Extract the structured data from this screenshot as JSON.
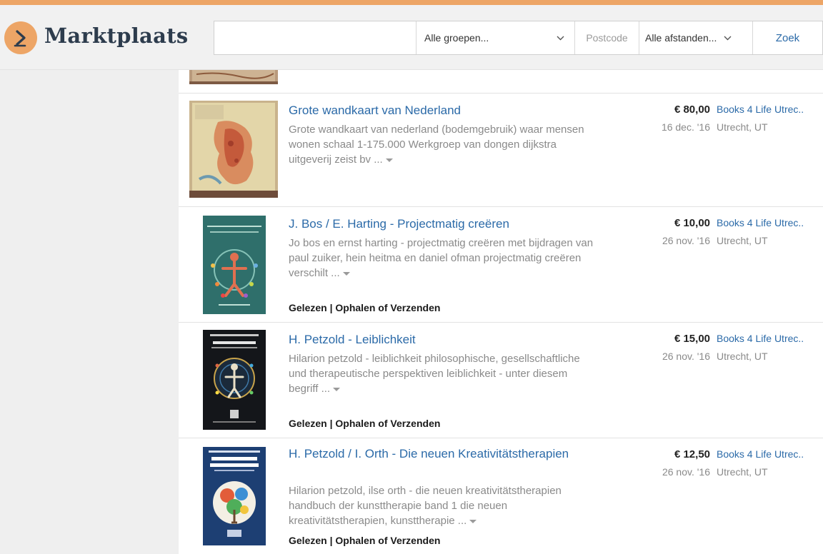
{
  "header": {
    "logo_text": "Marktplaats",
    "search": {
      "value": "",
      "placeholder": ""
    },
    "group_select": "Alle groepen...",
    "postcode_placeholder": "Postcode",
    "distance_select": "Alle afstanden...",
    "search_button": "Zoek"
  },
  "colors": {
    "accent": "#eda566",
    "link": "#2b6aa8",
    "logo_text": "#2d3c4d"
  },
  "listings": [
    {
      "title": "Grote wandkaart van Nederland",
      "description": "Grote wandkaart van nederland (bodemgebruik) waar mensen wonen schaal 1-175.000 Werkgroep van dongen dijkstra uitgeverij zeist bv ...",
      "attributes": "",
      "price": "€ 80,00",
      "date": "16 dec. '16",
      "seller": "Books 4 Life Utrec..",
      "location": "Utrecht, UT"
    },
    {
      "title": "J. Bos / E. Harting - Projectmatig creëren",
      "description": "Jo bos en ernst harting - projectmatig creëren met bijdragen van paul zuiker, hein heitma en daniel ofman projectmatig creëren verschilt ...",
      "attributes": "Gelezen | Ophalen of Verzenden",
      "price": "€ 10,00",
      "date": "26 nov. '16",
      "seller": "Books 4 Life Utrec..",
      "location": "Utrecht, UT"
    },
    {
      "title": "H. Petzold - Leiblichkeit",
      "description": "Hilarion petzold - leiblichkeit philosophische, gesellschaftliche und therapeutische perspektiven leiblichkeit - unter diesem begriff ...",
      "attributes": "Gelezen | Ophalen of Verzenden",
      "price": "€ 15,00",
      "date": "26 nov. '16",
      "seller": "Books 4 Life Utrec..",
      "location": "Utrecht, UT"
    },
    {
      "title": "H. Petzold / I. Orth - Die neuen Kreativitätstherapien",
      "description": "Hilarion petzold, ilse orth - die neuen kreativitätstherapien handbuch der kunsttherapie band 1 die neuen kreativitätstherapien, kunsttherapie ...",
      "attributes": "Gelezen | Ophalen of Verzenden",
      "price": "€ 12,50",
      "date": "26 nov. '16",
      "seller": "Books 4 Life Utrec..",
      "location": "Utrecht, UT"
    }
  ]
}
